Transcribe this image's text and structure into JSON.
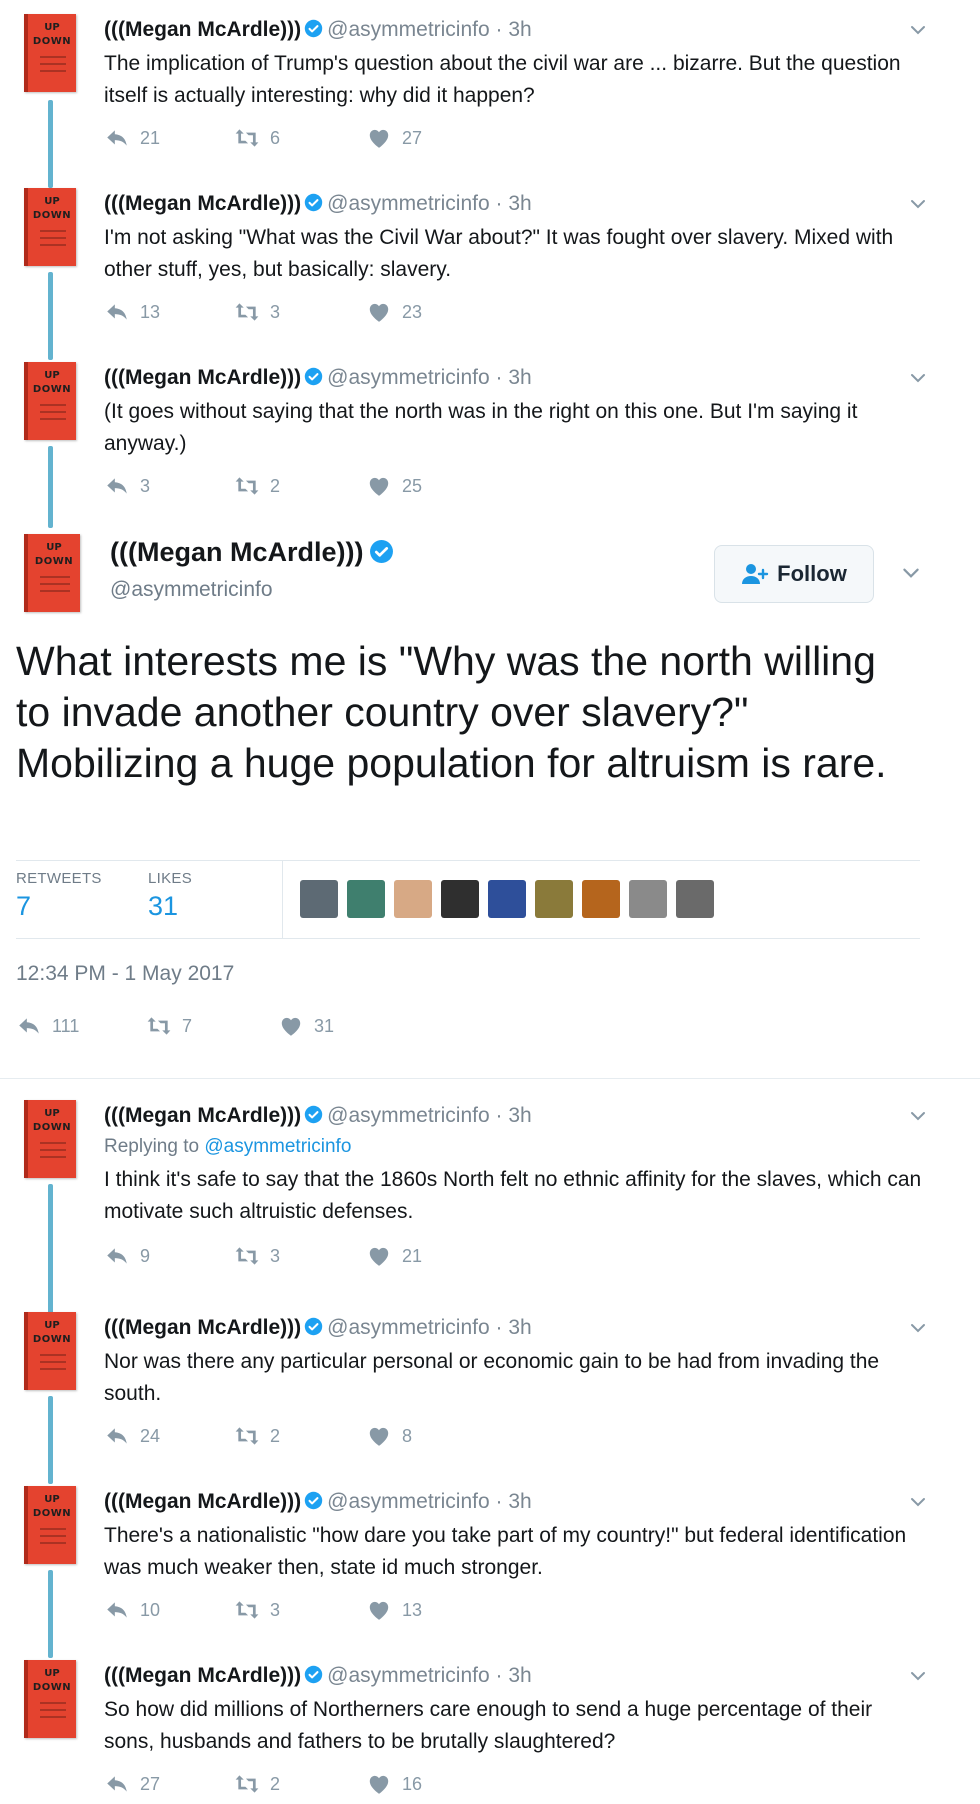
{
  "author": {
    "name": "(((Megan McArdle)))",
    "handle": "@asymmetricinfo",
    "avatar_text_top": "UP",
    "avatar_text_bottom": "DOWN"
  },
  "colors": {
    "accent": "#1b95e0",
    "thread_line": "#63b3cf",
    "avatar_book": "#e4432f",
    "muted": "#8899a6"
  },
  "icons": {
    "reply": "reply-icon",
    "retweet": "retweet-icon",
    "like": "heart-icon",
    "verified": "verified-badge-icon",
    "more": "chevron-down-icon",
    "follow": "add-user-icon"
  },
  "tweets_before": [
    {
      "time": "3h",
      "text": "The implication of Trump's question about the civil war are ... bizarre. But the question itself is actually interesting: why did it happen?",
      "replies": "21",
      "retweets": "6",
      "likes": "27"
    },
    {
      "time": "3h",
      "text": "I'm not asking \"What was the Civil War about?\" It was fought over slavery. Mixed with other stuff, yes, but basically: slavery.",
      "replies": "13",
      "retweets": "3",
      "likes": "23"
    },
    {
      "time": "3h",
      "text": "(It goes without saying that the north was in the right on this one. But I'm saying it anyway.)",
      "replies": "3",
      "retweets": "2",
      "likes": "25"
    }
  ],
  "focused": {
    "follow_label": "Follow",
    "text": "What interests me is \"Why was the north willing to invade another country over slavery?\" Mobilizing a huge population for altruism is rare.",
    "retweets_label": "RETWEETS",
    "retweets_count": "7",
    "likes_label": "LIKES",
    "likes_count": "31",
    "timestamp": "12:34 PM - 1 May 2017",
    "replies": "111",
    "retweets": "7",
    "likes": "31",
    "likers": [
      "#5d6a74",
      "#3f7f6e",
      "#d7a985",
      "#2f2f2f",
      "#2e4f9a",
      "#8a7a3a",
      "#b5651d",
      "#8a8a8a",
      "#6a6a6a"
    ]
  },
  "tweets_after": [
    {
      "time": "3h",
      "replying_prefix": "Replying to",
      "replying_to": "@asymmetricinfo",
      "text": "I think it's safe to say that the 1860s North felt no ethnic affinity for the slaves, which can motivate such altruistic defenses.",
      "replies": "9",
      "retweets": "3",
      "likes": "21"
    },
    {
      "time": "3h",
      "text": "Nor was there any particular personal or economic gain to be had from invading the south.",
      "replies": "24",
      "retweets": "2",
      "likes": "8"
    },
    {
      "time": "3h",
      "text": "There's a nationalistic \"how dare you take part of my country!\" but federal identification was much weaker then, state id much stronger.",
      "replies": "10",
      "retweets": "3",
      "likes": "13"
    },
    {
      "time": "3h",
      "text": "So how did millions of Northerners care enough to send a huge percentage of their sons, husbands and fathers to be brutally slaughtered?",
      "replies": "27",
      "retweets": "2",
      "likes": "16"
    }
  ]
}
